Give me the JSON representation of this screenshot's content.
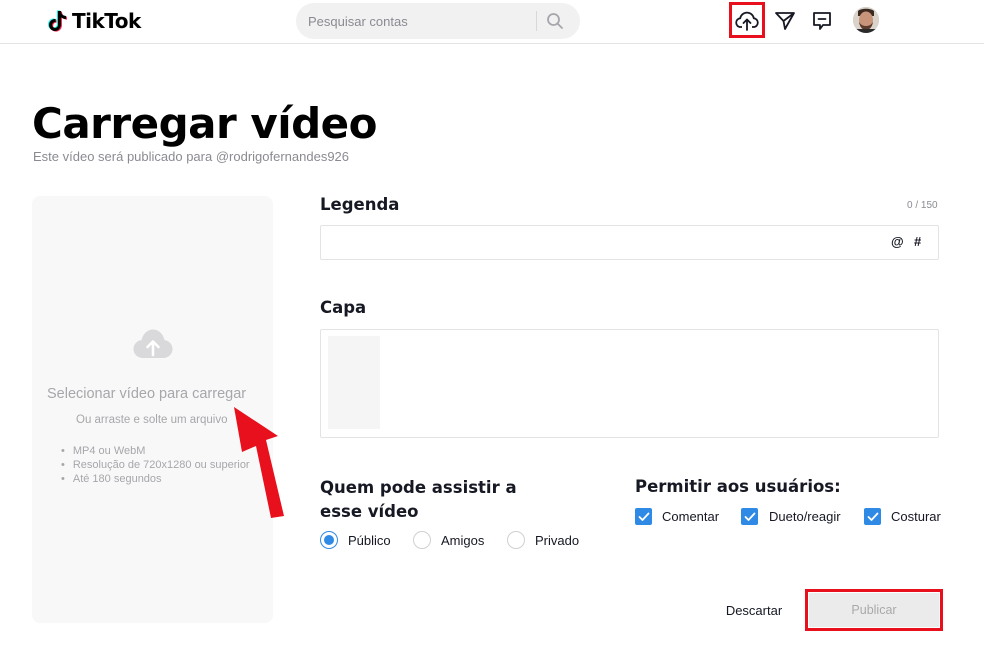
{
  "header": {
    "logo_text": "TikTok",
    "search_placeholder": "Pesquisar contas",
    "icons": [
      "upload-cloud-icon",
      "paper-plane-icon",
      "message-icon",
      "avatar"
    ]
  },
  "page": {
    "title": "Carregar vídeo",
    "subtitle": "Este vídeo será publicado para @rodrigofernandes926"
  },
  "upload": {
    "title": "Selecionar vídeo para carregar",
    "hint": "Ou arraste e solte um arquivo",
    "specs": [
      "MP4 ou WebM",
      "Resolução de 720x1280 ou superior",
      "Até 180 segundos"
    ]
  },
  "form": {
    "caption_label": "Legenda",
    "caption_counter": "0 / 150",
    "caption_value": "",
    "mention_symbol": "@",
    "hashtag_symbol": "#",
    "cover_label": "Capa",
    "privacy_label": "Quem pode assistir a esse vídeo",
    "privacy_options": [
      {
        "label": "Público",
        "checked": true
      },
      {
        "label": "Amigos",
        "checked": false
      },
      {
        "label": "Privado",
        "checked": false
      }
    ],
    "permissions_label": "Permitir aos usuários:",
    "permissions": [
      {
        "label": "Comentar",
        "checked": true
      },
      {
        "label": "Dueto/reagir",
        "checked": true
      },
      {
        "label": "Costurar",
        "checked": true
      }
    ],
    "discard_label": "Descartar",
    "publish_label": "Publicar"
  },
  "colors": {
    "accent_blue": "#2f8ae5",
    "annotation_red": "#e8101c",
    "muted_text": "#8a8b91"
  }
}
